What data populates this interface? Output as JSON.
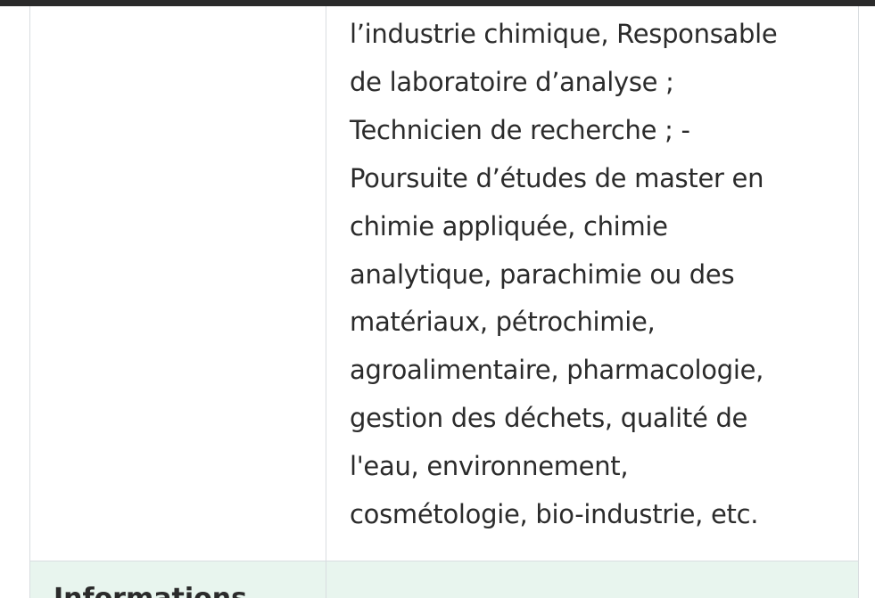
{
  "table": {
    "row": {
      "lines": [
        "l’industrie chimique, Responsable",
        "de laboratoire d’analyse ;",
        "Technicien de recherche ; -",
        "Poursuite d’études de master en",
        "chimie appliquée, chimie",
        "analytique, parachimie ou des",
        "matériaux, pétrochimie,",
        "agroalimentaire, pharmacologie,",
        "gestion des déchets, qualité de",
        "l'eau, environnement,",
        "cosmétologie, bio-industrie, etc."
      ]
    },
    "next_row": {
      "heading": "Informations"
    }
  }
}
